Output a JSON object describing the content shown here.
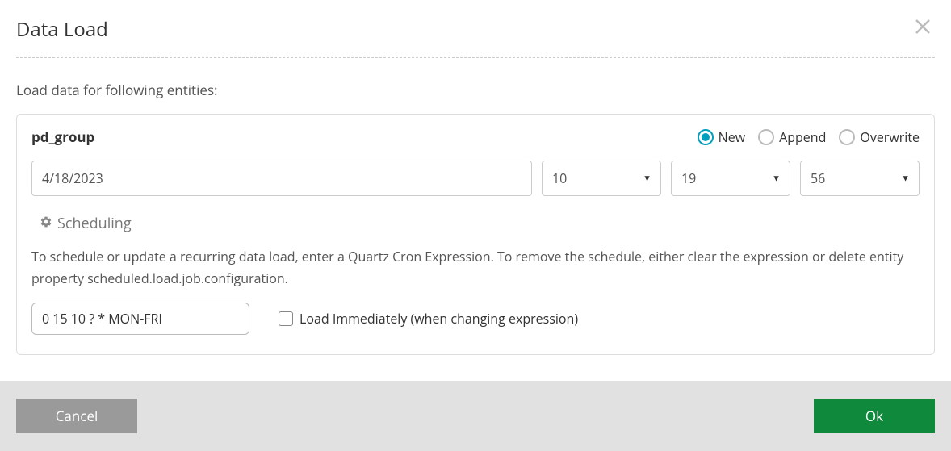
{
  "dialog": {
    "title": "Data Load",
    "subtitle": "Load data for following entities:"
  },
  "entity": {
    "name": "pd_group",
    "mode_options": {
      "new": "New",
      "append": "Append",
      "overwrite": "Overwrite"
    },
    "selected_mode": "new",
    "date": "4/18/2023",
    "hour": "10",
    "minute": "19",
    "second": "56"
  },
  "scheduling": {
    "title": "Scheduling",
    "description": "To schedule or update a recurring data load, enter a Quartz Cron Expression. To remove the schedule, either clear the expression or delete entity property scheduled.load.job.configuration.",
    "cron_expression": "0 15 10 ? * MON-FRI",
    "load_immediately_label": "Load Immediately (when changing expression)",
    "load_immediately_checked": false
  },
  "footer": {
    "cancel": "Cancel",
    "ok": "Ok"
  }
}
